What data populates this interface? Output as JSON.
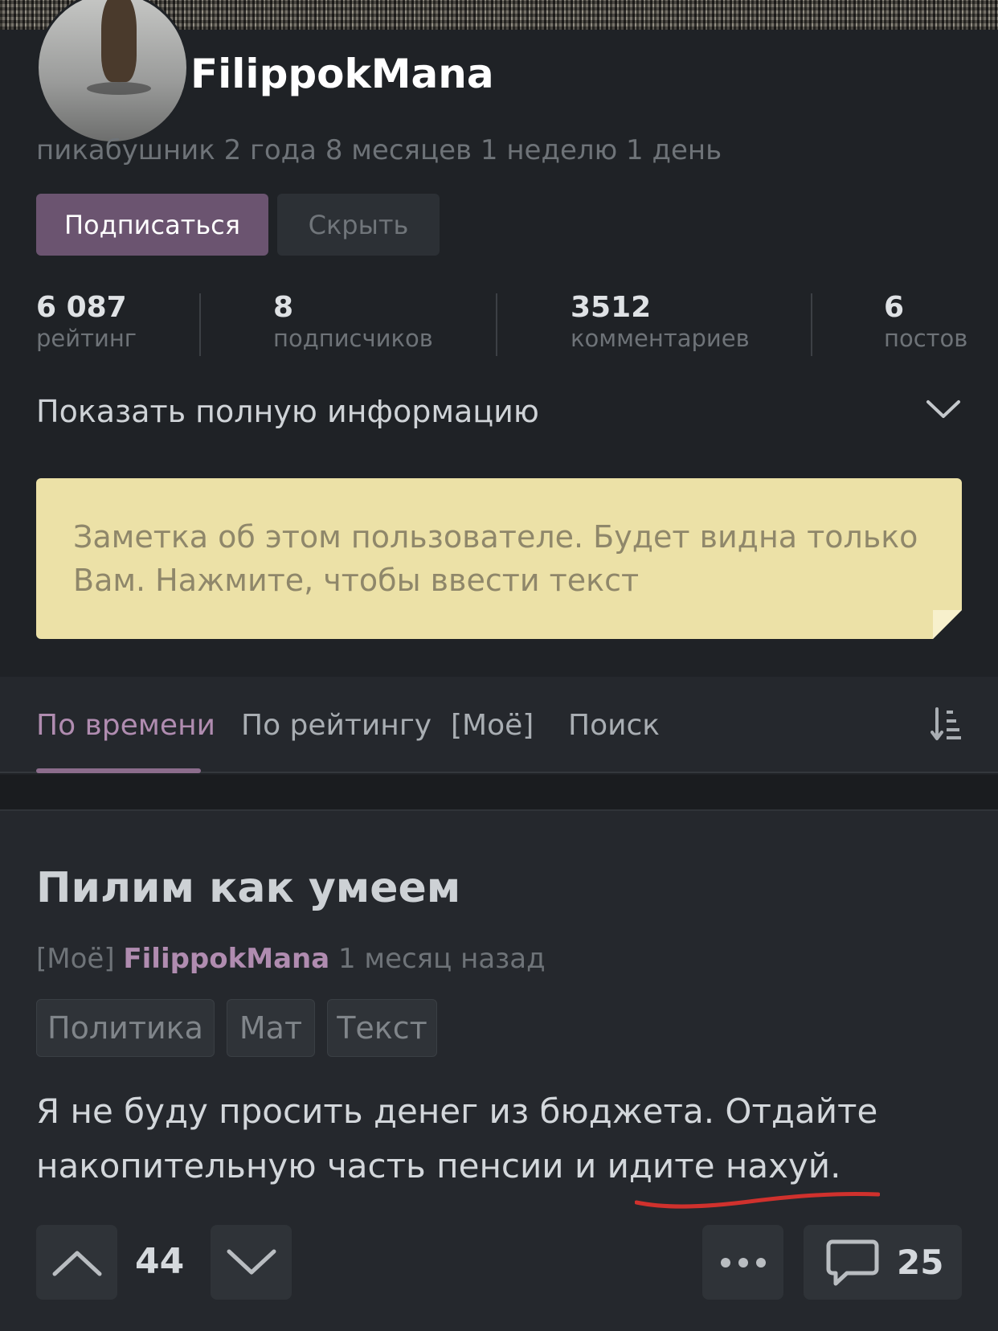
{
  "profile": {
    "username": "FilippokMana",
    "tenure": "пикабушник 2 года 8 месяцев 1 неделю 1 день",
    "subscribe_label": "Подписаться",
    "hide_label": "Скрыть",
    "stats": [
      {
        "value": "6 087",
        "label": "рейтинг"
      },
      {
        "value": "8",
        "label": "подписчиков"
      },
      {
        "value": "3512",
        "label": "комментариев"
      },
      {
        "value": "6",
        "label": "постов"
      }
    ],
    "show_info": "Показать полную информацию",
    "note_placeholder": "Заметка об этом пользователе. Будет видна только Вам. Нажмите, чтобы ввести текст"
  },
  "tabs": [
    {
      "label": "По времени",
      "active": true
    },
    {
      "label": "По рейтингу",
      "active": false
    },
    {
      "label": "[Моё]",
      "active": false
    },
    {
      "label": "Поиск",
      "active": false
    }
  ],
  "post": {
    "title": "Пилим как умеем",
    "meta_prefix": "[Моё]",
    "author": "FilippokMana",
    "time": "1 месяц назад",
    "tags": [
      "Политика",
      "Мат",
      "Текст"
    ],
    "body": "Я не буду просить денег из бюджета. Отдайте накопительную часть пенсии и идите нахуй.",
    "rating": "44",
    "comments_count": "25"
  },
  "colors": {
    "accent": "#6b5470",
    "accent_text": "#b08cb0",
    "note_bg": "#ece1a7",
    "annotation_red": "#d0312d"
  }
}
